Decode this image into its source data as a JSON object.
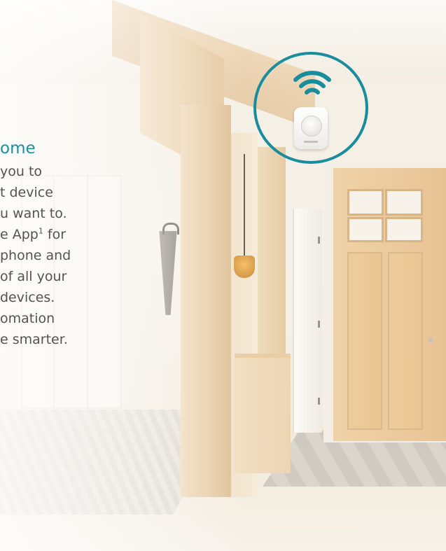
{
  "hero_text": {
    "heading": "ome",
    "lines": [
      "you to",
      "t device",
      "u want to.",
      "e App",
      "phone and",
      "of all your",
      "devices.",
      "omation",
      "e smarter."
    ],
    "footnote_marker": "1",
    "line4_suffix": " for"
  },
  "device_badge": {
    "icon": "wifi-icon",
    "product": "motion-sensor-icon",
    "accent_color": "#1a8d9d"
  },
  "colors": {
    "heading": "#1a90a3",
    "body": "#56534e"
  }
}
